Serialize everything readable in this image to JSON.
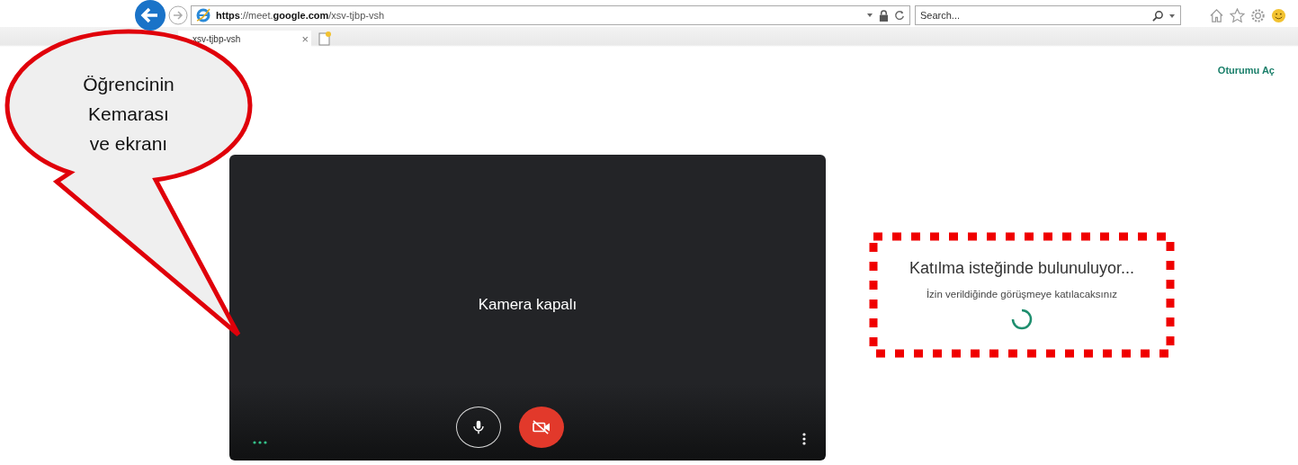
{
  "browser": {
    "url": "**https**://meet.**google.com**/xsv-tjbp-vsh",
    "search": {
      "placeholder": "Search..."
    },
    "tab": {
      "title": "xsv-tjbp-vsh",
      "close": "×"
    }
  },
  "page": {
    "sign_in": "Oturumu Aç",
    "camera_status": "Kamera kapalı",
    "controls": [
      {
        "kind": "mic",
        "on": true
      },
      {
        "kind": "camera",
        "on": false
      }
    ],
    "join": {
      "title": "Katılma isteğinde bulunuluyor...",
      "subtitle": "İzin verildiğinde görüşmeye katılacaksınız"
    }
  },
  "annotation": {
    "callout": "Öğrencinin\nKemarası\nve ekranı"
  }
}
